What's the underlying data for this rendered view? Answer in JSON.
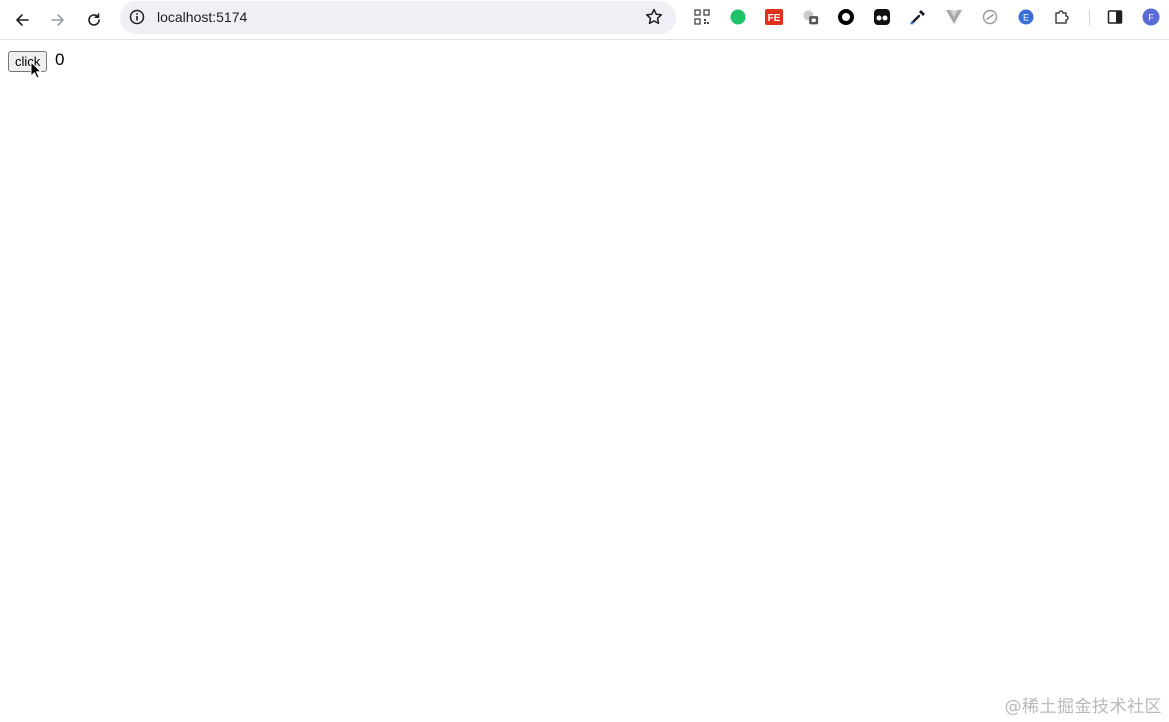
{
  "browser": {
    "url": "localhost:5174",
    "nav": {
      "back": "back-arrow-icon",
      "forward": "forward-arrow-icon",
      "reload": "reload-icon"
    },
    "omnibox_icons": [
      "info-icon",
      "bookmark-star-icon"
    ],
    "extensions": [
      {
        "name": "qr-code-extension-icon",
        "color": "#444444"
      },
      {
        "name": "green-circle-extension-icon",
        "color": "#1ec36a"
      },
      {
        "name": "fe-extension-icon",
        "color": "#e0301e",
        "text": "FE"
      },
      {
        "name": "cookie-badge-extension-icon",
        "color": "#888888"
      },
      {
        "name": "record-extension-icon",
        "color": "#000000"
      },
      {
        "name": "glasses-extension-icon",
        "color": "#111111"
      },
      {
        "name": "color-picker-extension-icon",
        "color": "#1a1a2e"
      },
      {
        "name": "vue-devtools-extension-icon",
        "color": "#9a9a9a"
      },
      {
        "name": "link-extension-icon",
        "color": "#9a9a9a"
      },
      {
        "name": "e-extension-icon",
        "color": "#3b6fd8",
        "text": "E"
      },
      {
        "name": "puzzle-extensions-icon",
        "color": "#444444"
      },
      {
        "name": "side-panel-icon",
        "color": "#1f1f1f"
      },
      {
        "name": "profile-avatar-icon",
        "color": "#5b6bd6",
        "text": "F"
      }
    ]
  },
  "page": {
    "button_label": "click",
    "count": "0"
  },
  "watermark": "@稀土掘金技术社区"
}
